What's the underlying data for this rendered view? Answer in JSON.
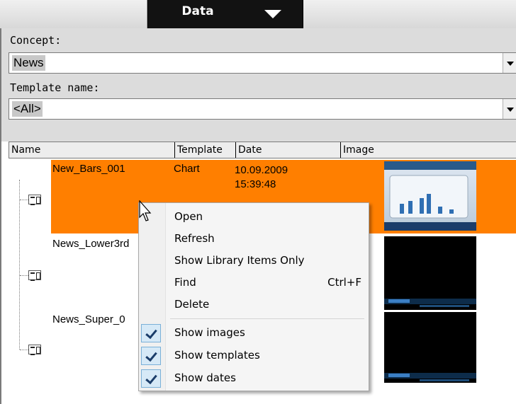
{
  "tabbar": {
    "title": "Data"
  },
  "form": {
    "concept_label": "Concept:",
    "concept_value": "News",
    "template_label": "Template name:",
    "template_value": "<All>"
  },
  "columns": [
    "Name",
    "Template",
    "Date",
    "Image"
  ],
  "rows": [
    {
      "name": "New_Bars_001",
      "template": "Chart",
      "date": "10.09.2009",
      "time": "15:39:48",
      "selected": true
    },
    {
      "name": "News_Lower3rd",
      "template": "",
      "date": "",
      "time": "",
      "selected": false
    },
    {
      "name": "News_Super_0",
      "template": "",
      "date": "",
      "time": "",
      "selected": false
    }
  ],
  "context_menu": {
    "items": [
      {
        "label": "Open",
        "shortcut": ""
      },
      {
        "label": "Refresh",
        "shortcut": ""
      },
      {
        "label": "Show Library Items Only",
        "shortcut": ""
      },
      {
        "label": "Find",
        "shortcut": "Ctrl+F"
      },
      {
        "label": "Delete",
        "shortcut": ""
      }
    ],
    "toggles": [
      {
        "label": "Show images",
        "checked": true
      },
      {
        "label": "Show templates",
        "checked": true
      },
      {
        "label": "Show dates",
        "checked": true
      }
    ]
  },
  "colors": {
    "selection": "#ff7f00",
    "tab_active": "#121212",
    "check_bg": "#d6e9f7"
  }
}
